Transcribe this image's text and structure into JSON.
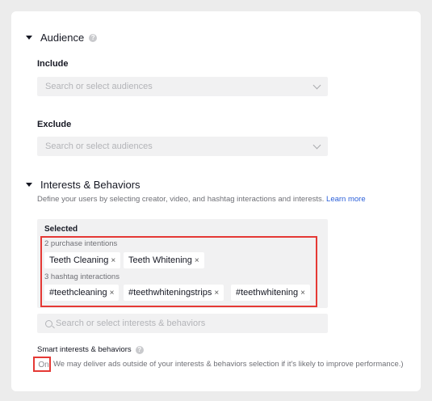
{
  "audience": {
    "title": "Audience",
    "include_label": "Include",
    "include_placeholder": "Search or select audiences",
    "exclude_label": "Exclude",
    "exclude_placeholder": "Search or select audiences"
  },
  "interests": {
    "title": "Interests & Behaviors",
    "description": "Define your users by selecting creator, video, and hashtag interactions and interests.",
    "learn_more": "Learn more",
    "selected_label": "Selected",
    "purchase_group_label": "2 purchase intentions",
    "purchase_chips": [
      "Teeth Cleaning",
      "Teeth Whitening"
    ],
    "hashtag_group_label": "3 hashtag interactions",
    "hashtag_chips": [
      "#teethcleaning",
      "#teethwhiteningstrips",
      "#teethwhitening"
    ],
    "remove_symbol": "×",
    "search_placeholder": "Search or select interests & behaviors"
  },
  "smart": {
    "label": "Smart interests & behaviors",
    "toggle_value": "On",
    "description": "We may deliver ads outside of your interests & behaviors selection if it's likely to improve performance.)"
  },
  "colors": {
    "highlight": "#e53935",
    "link": "#2b5fd9"
  }
}
